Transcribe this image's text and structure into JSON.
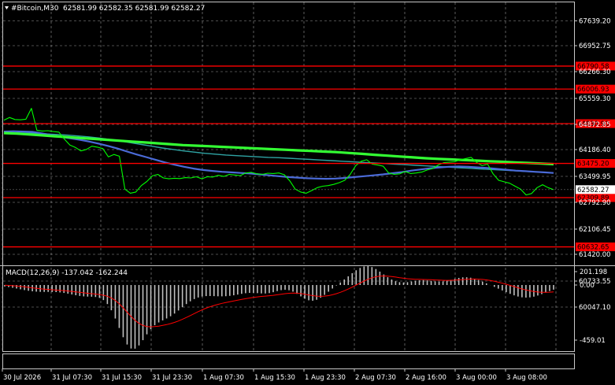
{
  "header": {
    "symbol_label": "#Bitcoin,M30",
    "ohlc": "62581.99 62582.35 62581.99 62582.27"
  },
  "price_axis": {
    "ticks": [
      "67639.20",
      "66952.75",
      "66266.30",
      "65559.30",
      "64872.85",
      "64186.40",
      "63499.95",
      "62792.90",
      "62106.45",
      "61420.00",
      "60733.55",
      "60047.10"
    ],
    "current_price": "62582.27",
    "current_price_value": 62582.27
  },
  "levels": [
    {
      "label": "66790.58",
      "value": 66790.58
    },
    {
      "label": "66006.93",
      "value": 66006.93
    },
    {
      "label": "64830.90",
      "value": 64830.9
    },
    {
      "label": "63475.20",
      "value": 63475.2
    },
    {
      "label": "62309.89",
      "value": 62309.89
    },
    {
      "label": "60632.65",
      "value": 60632.65
    }
  ],
  "macd": {
    "label": "MACD(12,26,9) -137.042 -162.244",
    "ticks": [
      "201.198",
      "0.00",
      "-459.01"
    ]
  },
  "time_axis": [
    "30 Jul 2026",
    "31 Jul 07:30",
    "31 Jul 15:30",
    "31 Jul 23:30",
    "1 Aug 07:30",
    "1 Aug 15:30",
    "1 Aug 23:30",
    "2 Aug 07:30",
    "2 Aug 16:00",
    "3 Aug 00:00",
    "3 Aug 08:00"
  ],
  "colors": {
    "background": "#000000",
    "price_line": "#00ff00",
    "level": "#ff0000",
    "ma_fast": "#4b6bd8",
    "ma_mid": "#2fa4a4",
    "ma_slow": "#33ff33",
    "macd_hist": "#c0c0c0",
    "macd_signal": "#ff0000",
    "grid": "#9a9a9a",
    "axis_text": "#ffffff",
    "current_bg": "#ffffff"
  },
  "chart_data": {
    "type": "line",
    "title": "#Bitcoin,M30",
    "x": [
      "30 Jul 2026",
      "31 Jul 07:30",
      "31 Jul 15:30",
      "31 Jul 23:30",
      "1 Aug 07:30",
      "1 Aug 15:30",
      "1 Aug 23:30",
      "2 Aug 07:30",
      "2 Aug 16:00",
      "3 Aug 00:00",
      "3 Aug 08:00"
    ],
    "ylim": [
      60047.1,
      67639.2
    ],
    "series": [
      {
        "values": [
          64950,
          65040,
          64970,
          64960,
          64980,
          65350,
          64600,
          64580,
          64590,
          64560,
          64540,
          64300,
          64100,
          64020,
          63900,
          63950,
          64060,
          64030,
          63980,
          63700,
          63780,
          63720,
          62600,
          62460,
          62500,
          62720,
          62860,
          63050,
          63100,
          62980,
          62950,
          62970,
          62960,
          62990,
          62980,
          63020,
          62950,
          63020,
          63010,
          63070,
          63030,
          63100,
          63080,
          63060,
          63150,
          63170,
          63120,
          63100,
          63140,
          63130,
          63150,
          63090,
          62880,
          62600,
          62500,
          62460,
          62550,
          62650,
          62700,
          62720,
          62760,
          62820,
          62900,
          63100,
          63400,
          63550,
          63600,
          63450,
          63420,
          63380,
          63150,
          63100,
          63120,
          63200,
          63130,
          63150,
          63180,
          63250,
          63300,
          63420,
          63500,
          63520,
          63530,
          63600,
          63640,
          63680,
          63510,
          63400,
          63450,
          63120,
          62900,
          62850,
          62800,
          62700,
          62600,
          62400,
          62450,
          62650,
          62750,
          62650,
          62582
        ]
      },
      {
        "values": [
          64560,
          64570,
          64560,
          64550,
          64500,
          64440,
          64380,
          64330,
          64280,
          64220,
          64150,
          64070,
          63980,
          63880,
          63780,
          63690,
          63600,
          63510,
          63430,
          63360,
          63300,
          63250,
          63220,
          63190,
          63170,
          63150,
          63130,
          63100,
          63070,
          63040,
          63010,
          62990,
          62970,
          62960,
          62950,
          62960,
          62980,
          63010,
          63040,
          63070,
          63100,
          63140,
          63180,
          63230,
          63270,
          63310,
          63340,
          63360,
          63370,
          63360,
          63340,
          63320,
          63290,
          63260,
          63230,
          63210,
          63190,
          63170,
          63150
        ]
      },
      {
        "values": [
          64530,
          64520,
          64510,
          64500,
          64480,
          64460,
          64440,
          64410,
          64380,
          64340,
          64290,
          64240,
          64180,
          64120,
          64060,
          64000,
          63950,
          63900,
          63860,
          63820,
          63790,
          63760,
          63740,
          63720,
          63700,
          63680,
          63670,
          63650,
          63630,
          63610,
          63590,
          63570,
          63550,
          63530,
          63510,
          63490,
          63470,
          63450,
          63430,
          63410,
          63390,
          63370,
          63350,
          63330,
          63310,
          63290,
          63270,
          63250,
          63230,
          63210,
          63190,
          63170,
          63150
        ]
      },
      {
        "values": [
          64510,
          64490,
          64460,
          64430,
          64400,
          64370,
          64340,
          64310,
          64280,
          64250,
          64220,
          64190,
          64160,
          64130,
          64100,
          64080,
          64060,
          64040,
          64020,
          64000,
          63980,
          63960,
          63940,
          63920,
          63900,
          63880,
          63860,
          63830,
          63800,
          63770,
          63740,
          63710,
          63680,
          63650,
          63630,
          63610,
          63590,
          63570,
          63550,
          63530,
          63510,
          63490,
          63470,
          63450
        ]
      }
    ]
  }
}
